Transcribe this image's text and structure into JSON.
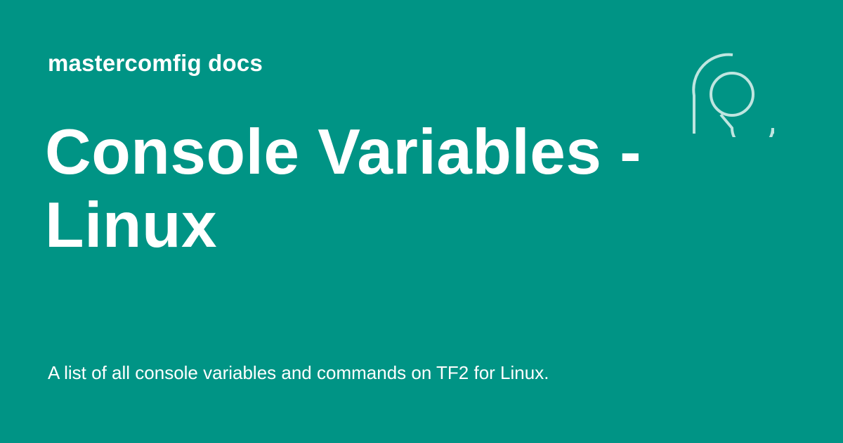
{
  "colors": {
    "background": "#009485",
    "text": "#ffffff",
    "logo_stroke": "#bfe5e0"
  },
  "header": {
    "site_name": "mastercomfig docs"
  },
  "title": "Console Variables - Linux",
  "description": "A list of all console variables and commands on TF2 for Linux.",
  "logo": {
    "icon": "mastercomfig-logo-icon"
  }
}
